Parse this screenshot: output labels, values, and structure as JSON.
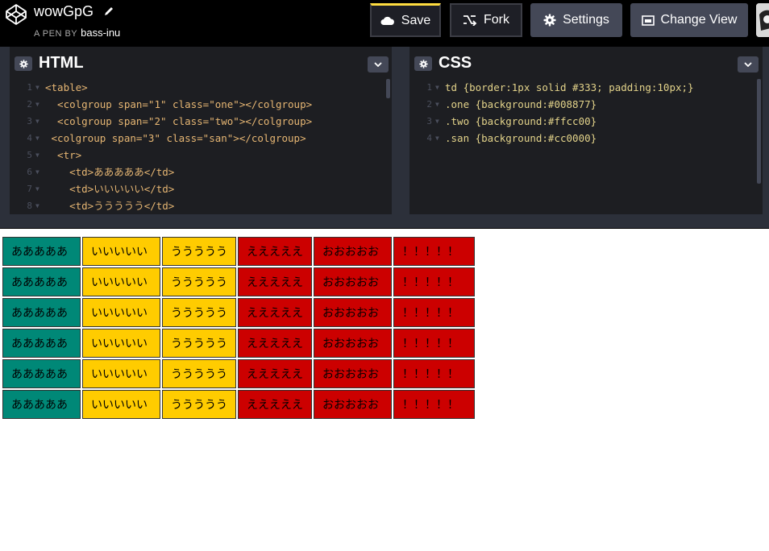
{
  "header": {
    "pen_title": "wowGpG",
    "byline_prefix": "A PEN BY",
    "author": "bass-inu",
    "buttons": {
      "save": "Save",
      "fork": "Fork",
      "settings": "Settings",
      "change_view": "Change View"
    }
  },
  "html_editor": {
    "title": "HTML",
    "lines": [
      {
        "n": "1",
        "text": "<table>"
      },
      {
        "n": "2",
        "text": "  <colgroup span=\"1\" class=\"one\"></colgroup>"
      },
      {
        "n": "3",
        "text": "  <colgroup span=\"2\" class=\"two\"></colgroup>"
      },
      {
        "n": "4",
        "text": " <colgroup span=\"3\" class=\"san\"></colgroup>"
      },
      {
        "n": "5",
        "text": "  <tr>"
      },
      {
        "n": "6",
        "text": "    <td>あああああ</td>"
      },
      {
        "n": "7",
        "text": "    <td>いいいいい</td>"
      },
      {
        "n": "8",
        "text": "    <td>ううううう</td>"
      }
    ]
  },
  "css_editor": {
    "title": "CSS",
    "lines": [
      {
        "n": "1",
        "text": "td {border:1px solid #333; padding:10px;}"
      },
      {
        "n": "2",
        "text": ".one {background:#008877}"
      },
      {
        "n": "3",
        "text": ".two {background:#ffcc00}"
      },
      {
        "n": "4",
        "text": ".san {background:#cc0000}"
      }
    ]
  },
  "result": {
    "column_colors": [
      "#008877",
      "#ffcc00",
      "#ffcc00",
      "#cc0000",
      "#cc0000",
      "#cc0000"
    ],
    "rows": [
      [
        "あああああ",
        "いいいいい",
        "ううううう",
        "えええええ",
        "おおおおお",
        "！！！！！"
      ],
      [
        "あああああ",
        "いいいいい",
        "ううううう",
        "えええええ",
        "おおおおお",
        "！！！！！"
      ],
      [
        "あああああ",
        "いいいいい",
        "ううううう",
        "えええええ",
        "おおおおお",
        "！！！！！"
      ],
      [
        "あああああ",
        "いいいいい",
        "ううううう",
        "えええええ",
        "おおおおお",
        "！！！！！"
      ],
      [
        "あああああ",
        "いいいいい",
        "ううううう",
        "えええええ",
        "おおおおお",
        "！！！！！"
      ],
      [
        "あああああ",
        "いいいいい",
        "ううううう",
        "えええええ",
        "おおおおお",
        "！！！！！"
      ]
    ]
  }
}
